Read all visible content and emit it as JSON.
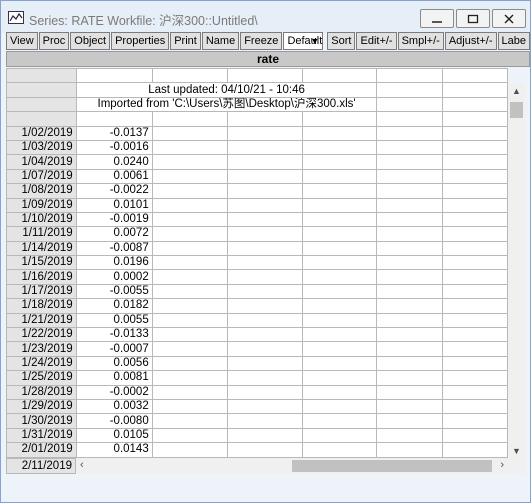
{
  "window": {
    "title": "Series: RATE   Workfile: 沪深300::Untitled\\"
  },
  "toolbar": {
    "buttons": [
      "View",
      "Proc",
      "Object",
      "Properties",
      "Print",
      "Name",
      "Freeze"
    ],
    "view_select": "Default",
    "buttons2": [
      "Sort",
      "Edit+/-",
      "Smpl+/-",
      "Adjust+/-",
      "Labe"
    ]
  },
  "series": {
    "name": "rate",
    "last_updated": "Last updated: 04/10/21 - 10:46",
    "imported_from": "Imported from 'C:\\Users\\苏图\\Desktop\\沪深300.xls'"
  },
  "rows": [
    {
      "date": "1/02/2019",
      "value": "-0.0137"
    },
    {
      "date": "1/03/2019",
      "value": "-0.0016"
    },
    {
      "date": "1/04/2019",
      "value": "0.0240"
    },
    {
      "date": "1/07/2019",
      "value": "0.0061"
    },
    {
      "date": "1/08/2019",
      "value": "-0.0022"
    },
    {
      "date": "1/09/2019",
      "value": "0.0101"
    },
    {
      "date": "1/10/2019",
      "value": "-0.0019"
    },
    {
      "date": "1/11/2019",
      "value": "0.0072"
    },
    {
      "date": "1/14/2019",
      "value": "-0.0087"
    },
    {
      "date": "1/15/2019",
      "value": "0.0196"
    },
    {
      "date": "1/16/2019",
      "value": "0.0002"
    },
    {
      "date": "1/17/2019",
      "value": "-0.0055"
    },
    {
      "date": "1/18/2019",
      "value": "0.0182"
    },
    {
      "date": "1/21/2019",
      "value": "0.0055"
    },
    {
      "date": "1/22/2019",
      "value": "-0.0133"
    },
    {
      "date": "1/23/2019",
      "value": "-0.0007"
    },
    {
      "date": "1/24/2019",
      "value": "0.0056"
    },
    {
      "date": "1/25/2019",
      "value": "0.0081"
    },
    {
      "date": "1/28/2019",
      "value": "-0.0002"
    },
    {
      "date": "1/29/2019",
      "value": "0.0032"
    },
    {
      "date": "1/30/2019",
      "value": "-0.0080"
    },
    {
      "date": "1/31/2019",
      "value": "0.0105"
    },
    {
      "date": "2/01/2019",
      "value": "0.0143"
    },
    {
      "date": "2/11/2019",
      "value": ""
    }
  ]
}
